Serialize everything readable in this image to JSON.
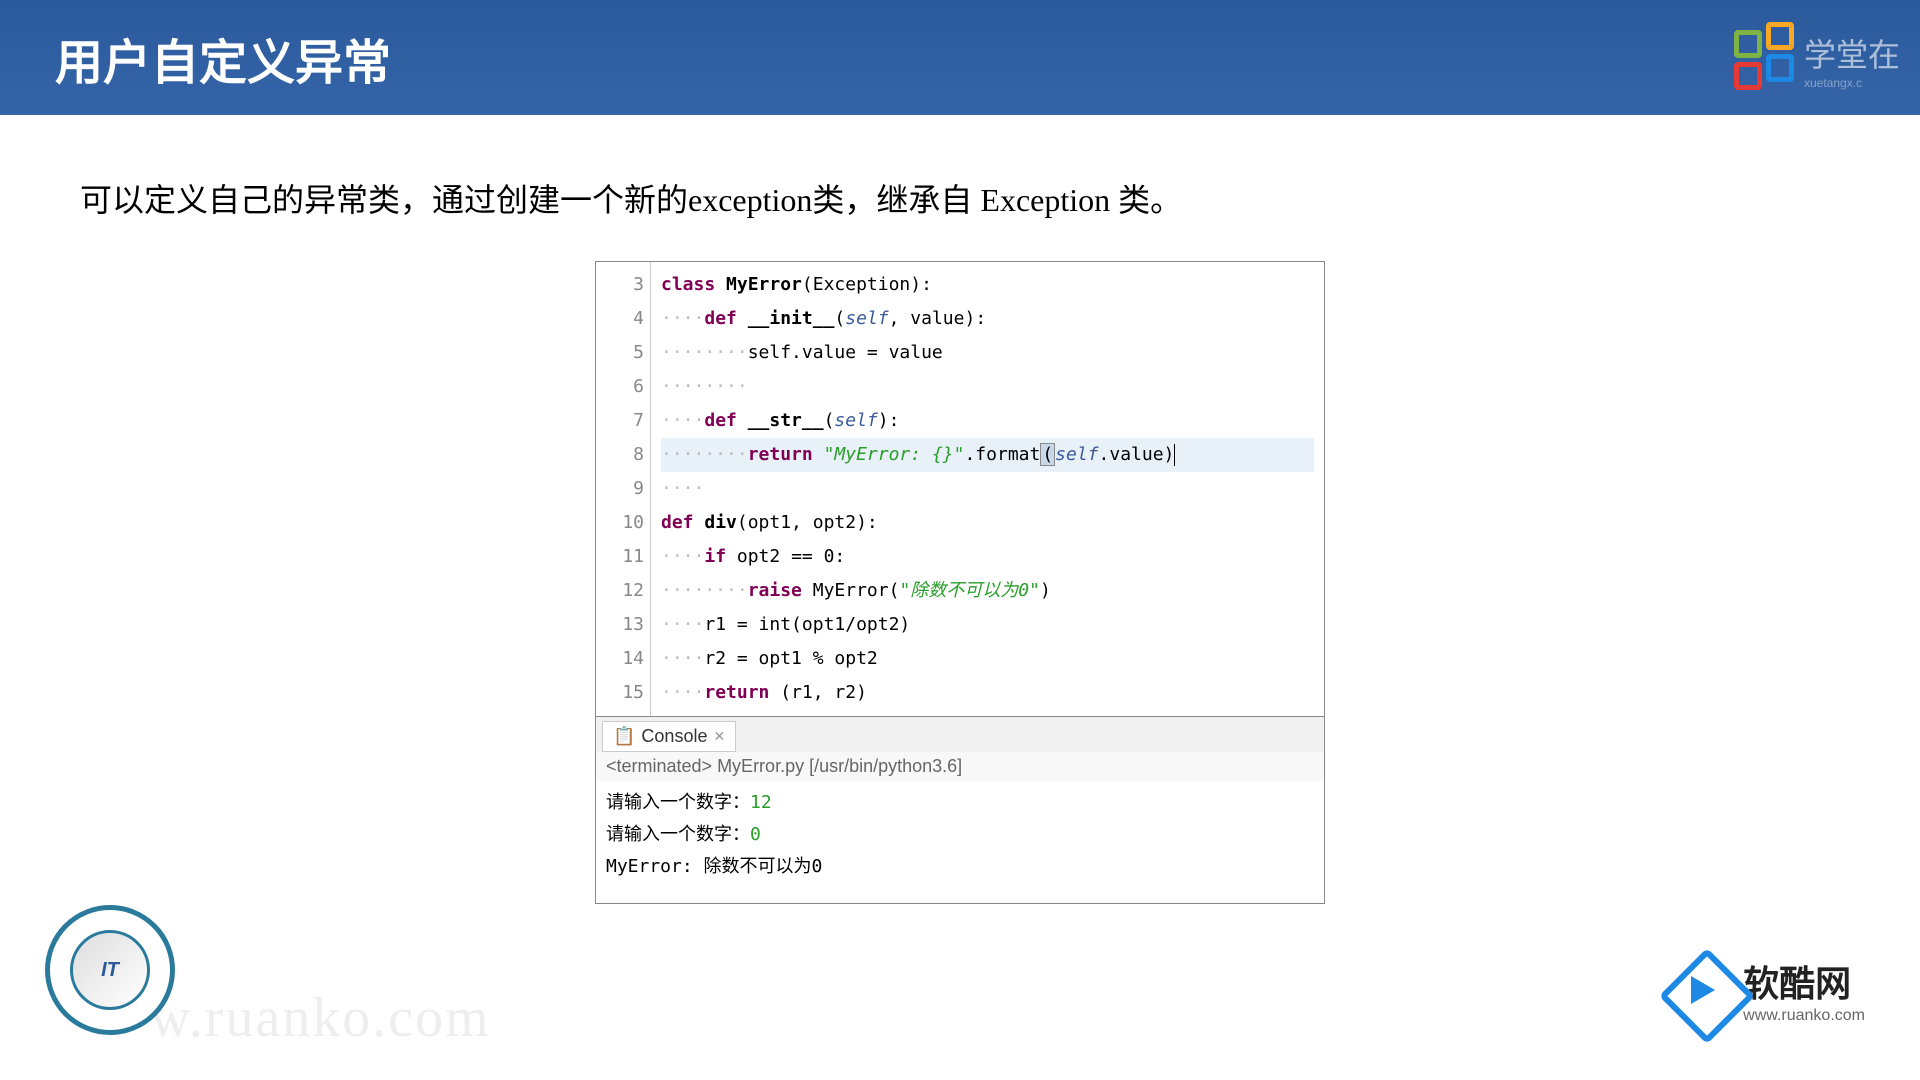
{
  "header": {
    "title": "用户自定义异常"
  },
  "brand": {
    "name": "学堂在",
    "sub": "xuetangx.c"
  },
  "description": "可以定义自己的异常类，通过创建一个新的exception类，继承自 Exception 类。",
  "gutter": [
    "3",
    "4",
    "5",
    "6",
    "7",
    "8",
    "9",
    "10",
    "11",
    "12",
    "13",
    "14",
    "15"
  ],
  "code": {
    "l3": {
      "kw": "class",
      "name": " MyError",
      "rest": "(Exception):"
    },
    "l4": {
      "dots": "····",
      "kw": "def",
      "name": " __init__",
      "open": "(",
      "self": "self",
      "rest": ", value):"
    },
    "l5": {
      "dots": "········",
      "rest": "self.value = value"
    },
    "l6": {
      "dots": "········"
    },
    "l7": {
      "dots": "····",
      "kw": "def",
      "name": " __str__",
      "open": "(",
      "self": "self",
      "rest": "):"
    },
    "l8": {
      "dots": "········",
      "kw": "return",
      "sp": " ",
      "str": "\"MyError: {}\"",
      "mid": ".format",
      "p1": "(",
      "self": "self",
      "after": ".value)"
    },
    "l9": {
      "dots": "····"
    },
    "l10": {
      "kw": "def",
      "name": " div",
      "rest": "(opt1, opt2):"
    },
    "l11": {
      "dots": "····",
      "kw": "if",
      "rest": " opt2 == 0:"
    },
    "l12": {
      "dots": "········",
      "kw": "raise",
      "mid": " MyError(",
      "str": "\"除数不可以为0\"",
      "rest": ")"
    },
    "l13": {
      "dots": "····",
      "rest": "r1 = int(opt1/opt2)"
    },
    "l14": {
      "dots": "····",
      "rest": "r2 = opt1 % opt2"
    },
    "l15": {
      "dots": "····",
      "kw": "return",
      "rest": " (r1, r2)"
    }
  },
  "console": {
    "tab": "Console",
    "close": "✕",
    "terminated": "<terminated> MyError.py [/usr/bin/python3.6]",
    "line1_prompt": "请输入一个数字：",
    "line1_val": "12",
    "line2_prompt": "请输入一个数字：",
    "line2_val": "0",
    "line3": "MyError: 除数不可以为0"
  },
  "badge": "IT",
  "watermark": "w.ruanko.com",
  "footer": {
    "cn": "软酷网",
    "url": "www.ruanko.com"
  }
}
